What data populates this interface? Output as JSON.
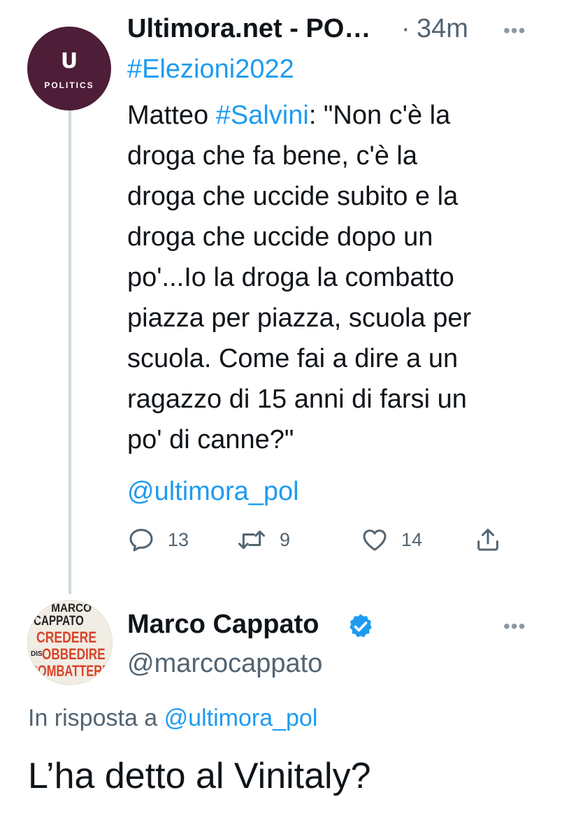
{
  "tweet1": {
    "avatar": {
      "logo": "U",
      "label": "POLITICS",
      "color": "#4e1d38"
    },
    "author_name": "Ultimora.net - PO…",
    "separator": "·",
    "time": "34m",
    "more": "•••",
    "hashtag": "#Elezioni2022",
    "text": {
      "l1_a": "Matteo ",
      "l1_link": "#Salvini",
      "l1_b": ": \"Non c'è la",
      "l2": "droga che fa bene, c'è la",
      "l3": "droga che uccide subito e la",
      "l4": "droga che uccide dopo un",
      "l5": "po'...Io la droga la combatto",
      "l6": "piazza per piazza, scuola per",
      "l7": "scuola. Come fai a dire a un",
      "l8": "ragazzo di 15 anni di farsi un",
      "l9": "po' di canne?\""
    },
    "mention": "@ultimora_pol",
    "actions": {
      "replies": "13",
      "retweets": "9",
      "likes": "14"
    }
  },
  "tweet2": {
    "avatar": {
      "line1": "MARCO",
      "line2": "CAPPATO",
      "line3": "CREDERE",
      "line4_prefix": "DIS",
      "line4": "OBBEDIRE",
      "line5": "COMBATTERE"
    },
    "author_name": "Marco Cappato",
    "handle": "@marcocappato",
    "more": "•••",
    "reply_prefix": "In risposta a ",
    "reply_to": "@ultimora_pol",
    "text": "L’ha detto al Vinitaly?"
  },
  "colors": {
    "accent": "#1d9bf0",
    "secondary_text": "#536471",
    "thread_line": "#cfd9de"
  }
}
